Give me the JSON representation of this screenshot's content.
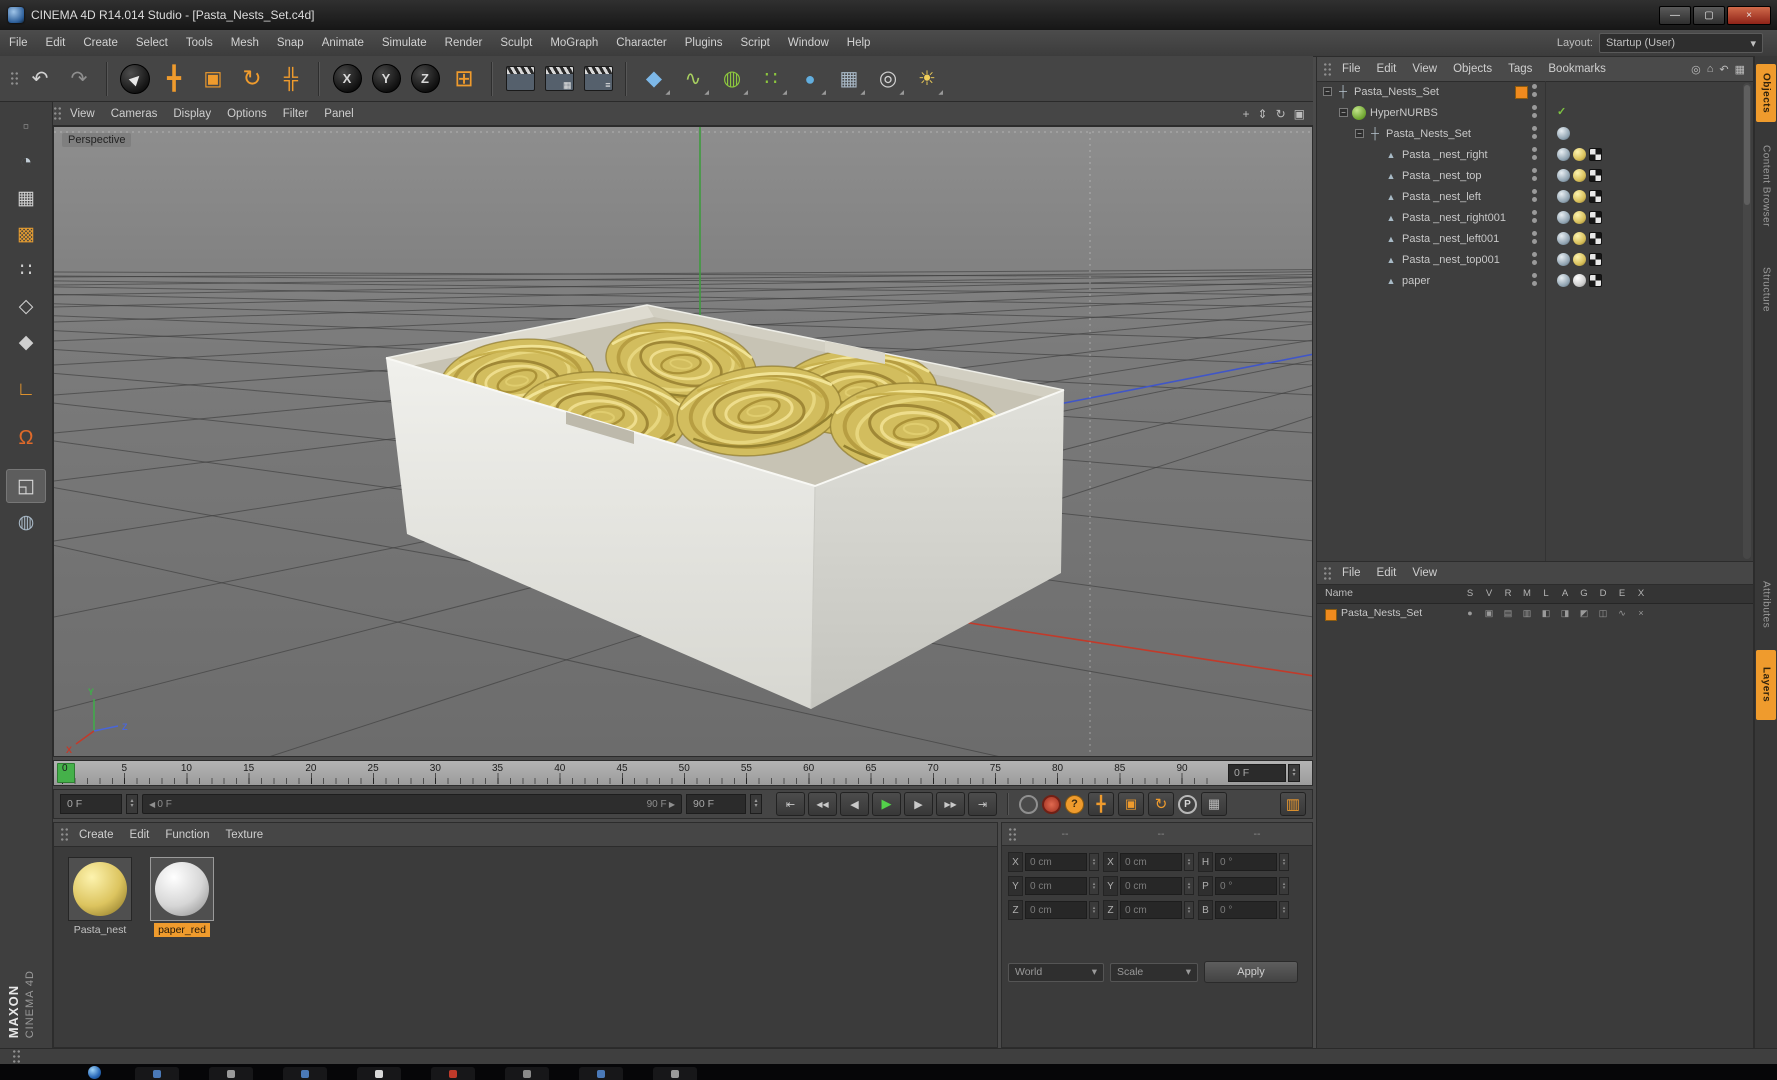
{
  "theme": {
    "accent": "#ef9b2d",
    "viewport_gray": "#7b7b7b",
    "pasta_yellow": "#d8c25e"
  },
  "window": {
    "title": "CINEMA 4D R14.014 Studio - [Pasta_Nests_Set.c4d]",
    "minimize_glyph": "—",
    "maximize_glyph": "▢",
    "close_glyph": "×"
  },
  "menubar": {
    "items": [
      "File",
      "Edit",
      "Create",
      "Select",
      "Tools",
      "Mesh",
      "Snap",
      "Animate",
      "Simulate",
      "Render",
      "Sculpt",
      "MoGraph",
      "Character",
      "Plugins",
      "Script",
      "Window",
      "Help"
    ],
    "layout_label": "Layout:",
    "layout_value": "Startup (User)",
    "layout_caret": "▾"
  },
  "toolbar": {
    "items": [
      {
        "name": "undo-button",
        "glyph": "↶",
        "color": "#d2d2d2",
        "size": 20
      },
      {
        "name": "redo-button",
        "glyph": "↷",
        "color": "#8f8f8f",
        "size": 20
      },
      {
        "type": "sep"
      },
      {
        "name": "live-selection-tool",
        "glyph": "▶",
        "tile": "round",
        "rot": -45,
        "color": "#e9e9e9",
        "size": 13
      },
      {
        "name": "move-tool",
        "glyph": "╋",
        "color": "#ef9b2d",
        "size": 23
      },
      {
        "name": "scale-tool",
        "glyph": "▣",
        "color": "#ef9b2d",
        "size": 20
      },
      {
        "name": "rotate-tool",
        "glyph": "↻",
        "color": "#ef9b2d",
        "size": 23
      },
      {
        "name": "last-used-tool",
        "glyph": "╬",
        "color": "#ef9b2d",
        "size": 20
      },
      {
        "type": "sep"
      },
      {
        "name": "lock-x-axis-button",
        "letter": "X"
      },
      {
        "name": "lock-y-axis-button",
        "letter": "Y"
      },
      {
        "name": "lock-z-axis-button",
        "letter": "Z"
      },
      {
        "name": "coordinate-system-button",
        "glyph": "⊞",
        "color": "#ef9b2d",
        "size": 23
      },
      {
        "type": "sep"
      },
      {
        "name": "render-view-button",
        "clapper": true,
        "overlay": ""
      },
      {
        "name": "render-picture-viewer-button",
        "clapper": true,
        "overlay": "▦"
      },
      {
        "name": "render-settings-button",
        "clapper": true,
        "overlay": "≡"
      },
      {
        "type": "sep"
      },
      {
        "name": "add-cube-button",
        "glyph": "◆",
        "color": "#7db8e8",
        "caret": true,
        "size": 21
      },
      {
        "name": "spline-pen-button",
        "glyph": "∿",
        "color": "#a8d060",
        "caret": true,
        "size": 20
      },
      {
        "name": "hypernurbs-button",
        "glyph": "◍",
        "color": "#8cc63e",
        "caret": true,
        "size": 21
      },
      {
        "name": "array-button",
        "glyph": "∷",
        "color": "#8cc63e",
        "caret": true,
        "size": 20
      },
      {
        "name": "metaball-button",
        "glyph": "●",
        "color": "#62aede",
        "caret": true,
        "size": 18
      },
      {
        "name": "floor-button",
        "glyph": "▦",
        "color": "#a8b8c6",
        "caret": true,
        "size": 20
      },
      {
        "name": "camera-button",
        "glyph": "◎",
        "color": "#cfcfcf",
        "caret": true,
        "size": 21
      },
      {
        "name": "light-button",
        "glyph": "☀",
        "color": "#f2d05a",
        "caret": true,
        "size": 20
      }
    ]
  },
  "left_toolbar": {
    "items": [
      {
        "name": "workplane-grid-button",
        "glyph": "▫",
        "color": "#8a8a8a",
        "size": 18
      },
      {
        "name": "make-editable-button",
        "glyph": "◔",
        "color": "#c2cdd6",
        "size": 20
      },
      {
        "name": "model-mode-button",
        "glyph": "▦",
        "color": "#cfcfcf",
        "size": 19
      },
      {
        "name": "texture-mode-button",
        "glyph": "▩",
        "color": "#e09a32",
        "size": 19
      },
      {
        "name": "points-mode-button",
        "glyph": "∷",
        "color": "#cfcfcf",
        "size": 19
      },
      {
        "name": "edges-mode-button",
        "glyph": "◇",
        "color": "#cfcfcf",
        "size": 19
      },
      {
        "name": "polygons-mode-button",
        "glyph": "◆",
        "color": "#cfcfcf",
        "size": 19
      },
      {
        "type": "gap"
      },
      {
        "name": "enable-axis-button",
        "glyph": "∟",
        "color": "#ef9b2d",
        "size": 19
      },
      {
        "type": "gap"
      },
      {
        "name": "snap-button",
        "glyph": "Ω",
        "color": "#e06a2a",
        "size": 20
      },
      {
        "type": "gap"
      },
      {
        "name": "workplane-mode-button",
        "glyph": "◱",
        "color": "#d8d8d8",
        "size": 19,
        "active": true
      },
      {
        "name": "lock-workplane-button",
        "glyph": "◍",
        "color": "#a8b8c6",
        "size": 19
      }
    ]
  },
  "viewport": {
    "label": "Perspective",
    "menu": [
      "View",
      "Cameras",
      "Display",
      "Options",
      "Filter",
      "Panel"
    ],
    "corner_icons": [
      {
        "name": "pan-view-icon",
        "glyph": "+"
      },
      {
        "name": "dolly-view-icon",
        "glyph": "⇕"
      },
      {
        "name": "rotate-view-icon",
        "glyph": "↻"
      },
      {
        "name": "toggle-view-icon",
        "glyph": "▣"
      }
    ],
    "axis_gizmo": {
      "x": "X",
      "y": "Y",
      "z": "Z"
    }
  },
  "timeline": {
    "ticks": [
      0,
      5,
      10,
      15,
      20,
      25,
      30,
      35,
      40,
      45,
      50,
      55,
      60,
      65,
      70,
      75,
      80,
      85,
      90
    ],
    "frame_field": "0 F"
  },
  "transport": {
    "frame_start": "0 F",
    "frame_end": "90 F",
    "range_start": "0 F",
    "range_end": "90 F",
    "buttons": [
      {
        "name": "goto-start-button",
        "glyph": "⇤"
      },
      {
        "name": "goto-prev-key-button",
        "glyph": "◀◀",
        "small": true
      },
      {
        "name": "prev-frame-button",
        "glyph": "◀"
      },
      {
        "name": "play-button",
        "glyph": "▶",
        "play": true
      },
      {
        "name": "next-frame-button",
        "glyph": "▶"
      },
      {
        "name": "goto-next-key-button",
        "glyph": "▶▶",
        "small": true
      },
      {
        "name": "goto-end-button",
        "glyph": "⇥"
      }
    ],
    "record_buttons": [
      {
        "name": "record-objects-button",
        "kind": "rec-gray",
        "glyph": ""
      },
      {
        "name": "autokey-button",
        "kind": "rec-red",
        "glyph": ""
      },
      {
        "name": "record-help-button",
        "kind": "rec-orange",
        "glyph": "?"
      },
      {
        "name": "key-position-toggle",
        "glyph": "╋",
        "color": "#ef9b2d",
        "size": 15
      },
      {
        "name": "key-scale-toggle",
        "glyph": "▣",
        "color": "#ef9b2d",
        "size": 13
      },
      {
        "name": "key-rotation-toggle",
        "glyph": "↻",
        "color": "#ef9b2d",
        "size": 15
      },
      {
        "name": "key-parameter-toggle",
        "kind": "rec-p",
        "glyph": "P"
      },
      {
        "name": "key-pla-toggle",
        "glyph": "▦",
        "color": "#b8b8b8",
        "size": 13
      }
    ],
    "far_button": {
      "name": "keyframe-presets-button",
      "glyph": "▥",
      "color": "#ef9b2d",
      "size": 15
    }
  },
  "materials": {
    "menu": [
      "Create",
      "Edit",
      "Function",
      "Texture"
    ],
    "items": [
      {
        "name": "Pasta_nest",
        "ball": "yellow",
        "selected": false
      },
      {
        "name": "paper_red",
        "ball": "white",
        "selected": true
      }
    ]
  },
  "coordinates": {
    "groups": [
      {
        "header": "--",
        "rows": [
          {
            "label": "X",
            "value": "0 cm"
          },
          {
            "label": "Y",
            "value": "0 cm"
          },
          {
            "label": "Z",
            "value": "0 cm"
          }
        ]
      },
      {
        "header": "--",
        "rows": [
          {
            "label": "X",
            "value": "0 cm"
          },
          {
            "label": "Y",
            "value": "0 cm"
          },
          {
            "label": "Z",
            "value": "0 cm"
          }
        ]
      },
      {
        "header": "--",
        "rows": [
          {
            "label": "H",
            "value": "0 °"
          },
          {
            "label": "P",
            "value": "0 °"
          },
          {
            "label": "B",
            "value": "0 °"
          }
        ]
      }
    ],
    "dropdown_left": "World",
    "dropdown_right": "Scale",
    "dd_caret": "▾",
    "apply_label": "Apply"
  },
  "object_manager": {
    "menu": [
      "File",
      "Edit",
      "View",
      "Objects",
      "Tags",
      "Bookmarks"
    ],
    "corner_icons": [
      {
        "name": "search-icon",
        "glyph": "◎"
      },
      {
        "name": "home-icon",
        "glyph": "⌂"
      },
      {
        "name": "back-icon",
        "glyph": "↶"
      },
      {
        "name": "grid-icon",
        "glyph": "▦"
      }
    ],
    "tree": [
      {
        "label": "Pasta_Nests_Set",
        "depth": 0,
        "icon": "null",
        "expand": true,
        "right": [
          "chip",
          "dots"
        ],
        "tags": []
      },
      {
        "label": "HyperNURBS",
        "depth": 1,
        "icon": "hn",
        "expand": true,
        "right": [
          "dots",
          "check"
        ],
        "tags": []
      },
      {
        "label": "Pasta_Nests_Set",
        "depth": 2,
        "icon": "null",
        "expand": true,
        "right": [
          "dots"
        ],
        "tags": [
          "phong"
        ]
      },
      {
        "label": "Pasta _nest_right",
        "depth": 3,
        "icon": "poly",
        "right": [
          "dots"
        ],
        "tags": [
          "phong",
          "mat-yellow",
          "uvw"
        ]
      },
      {
        "label": "Pasta _nest_top",
        "depth": 3,
        "icon": "poly",
        "right": [
          "dots"
        ],
        "tags": [
          "phong",
          "mat-yellow",
          "uvw"
        ]
      },
      {
        "label": "Pasta _nest_left",
        "depth": 3,
        "icon": "poly",
        "right": [
          "dots"
        ],
        "tags": [
          "phong",
          "mat-yellow",
          "uvw"
        ]
      },
      {
        "label": "Pasta _nest_right001",
        "depth": 3,
        "icon": "poly",
        "right": [
          "dots"
        ],
        "tags": [
          "phong",
          "mat-yellow",
          "uvw"
        ]
      },
      {
        "label": "Pasta _nest_left001",
        "depth": 3,
        "icon": "poly",
        "right": [
          "dots"
        ],
        "tags": [
          "phong",
          "mat-yellow",
          "uvw"
        ]
      },
      {
        "label": "Pasta _nest_top001",
        "depth": 3,
        "icon": "poly",
        "right": [
          "dots"
        ],
        "tags": [
          "phong",
          "mat-yellow",
          "uvw"
        ]
      },
      {
        "label": "paper",
        "depth": 3,
        "icon": "poly",
        "right": [
          "dots"
        ],
        "tags": [
          "phong",
          "mat-gray",
          "uvw"
        ]
      }
    ]
  },
  "layer_manager": {
    "menu": [
      "File",
      "Edit",
      "View"
    ],
    "name_header": "Name",
    "columns": [
      "S",
      "V",
      "R",
      "M",
      "L",
      "A",
      "G",
      "D",
      "E",
      "X"
    ],
    "rows": [
      {
        "label": "Pasta_Nests_Set"
      }
    ]
  },
  "side_tabs": {
    "top": [
      {
        "label": "Objects",
        "active": true
      },
      {
        "label": "Content Browser",
        "active": false
      },
      {
        "label": "Structure",
        "active": false
      }
    ],
    "bottom": [
      {
        "label": "Attributes",
        "active": false
      },
      {
        "label": "Layers",
        "active": true
      }
    ]
  },
  "branding": {
    "maxon": "MAXON",
    "cinema": "CINEMA 4D"
  },
  "taskbar": {
    "chips": [
      "#4a79b8",
      "#9a9a9a",
      "#4a79b8",
      "#d8d8d8",
      "#c03a2a",
      "#8a8a8a",
      "#4a79b8",
      "#9a9a9a"
    ]
  }
}
